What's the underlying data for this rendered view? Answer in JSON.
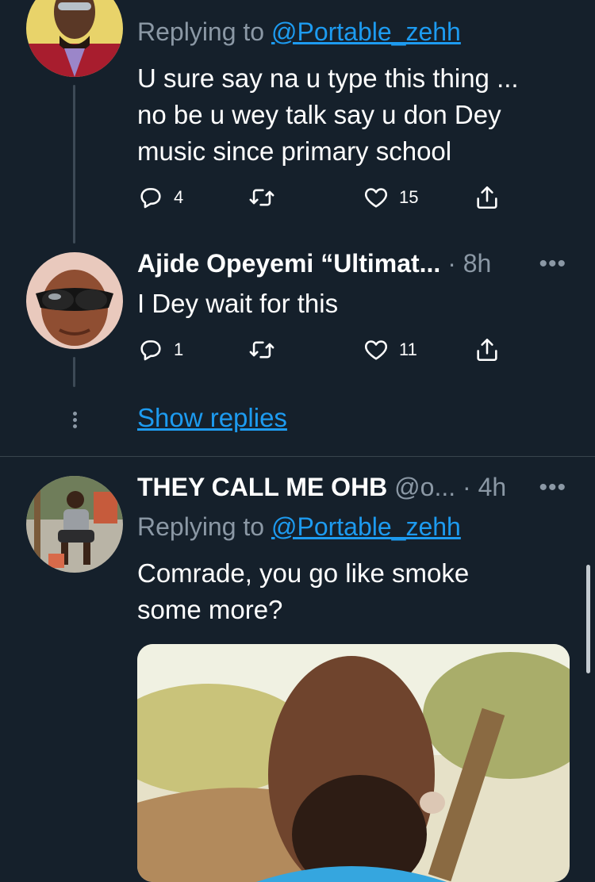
{
  "tweet1": {
    "replying_prefix": "Replying to",
    "replying_handle": "@Portable_zehh",
    "text_line1": "U sure say na u type this thing ...",
    "text_line2": "no be u wey talk say u don Dey",
    "text_line3": "music since primary school",
    "replies": "4",
    "likes": "15"
  },
  "tweet2": {
    "name": "Ajide Opeyemi “Ultimat...",
    "meta": " · 8h",
    "text": "I Dey wait for this",
    "replies": "1",
    "likes": "11"
  },
  "show_replies": "Show replies",
  "tweet3": {
    "name": "THEY CALL ME OHB",
    "handle": " @o...",
    "meta": " · 4h",
    "replying_prefix": "Replying to",
    "replying_handle": "@Portable_zehh",
    "text_line1": "Comrade, you go like smoke",
    "text_line2": "some more?"
  },
  "colors": {
    "background": "#15202b",
    "link": "#1d9bf0",
    "secondary_text": "#8b98a5"
  },
  "icons": [
    "reply-icon",
    "retweet-icon",
    "like-icon",
    "share-icon",
    "more-icon"
  ]
}
